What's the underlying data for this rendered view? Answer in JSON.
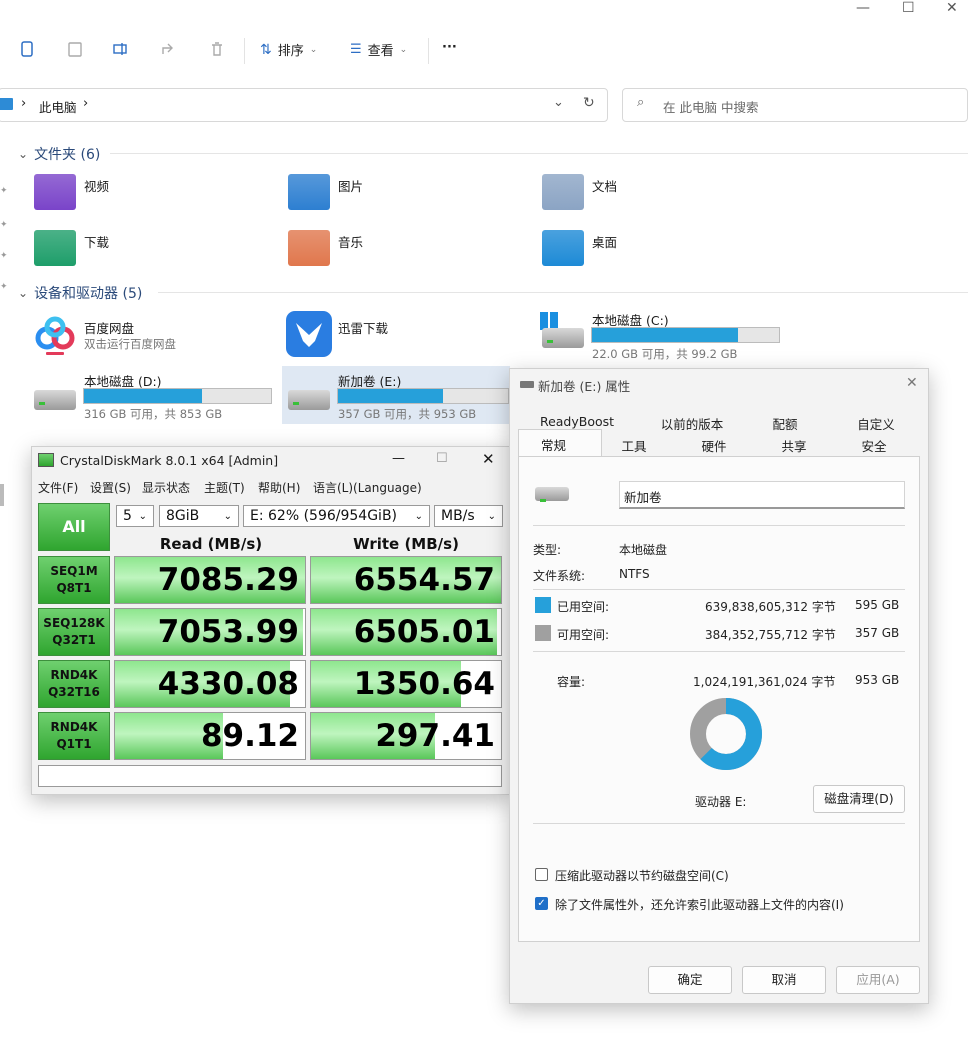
{
  "explorer": {
    "toolbar": {
      "sort_label": "排序",
      "view_label": "查看",
      "more_label": "···"
    },
    "address": {
      "root": "此电脑",
      "sep": "›"
    },
    "search": {
      "placeholder": "在 此电脑 中搜索"
    },
    "folders": {
      "header": "文件夹 (6)",
      "items": [
        {
          "name": "视频",
          "color": "#7a44c9"
        },
        {
          "name": "图片",
          "color": "#2d7fd1"
        },
        {
          "name": "文档",
          "color": "#8ba4c4"
        },
        {
          "name": "下载",
          "color": "#1e9e6a"
        },
        {
          "name": "音乐",
          "color": "#e0774d"
        },
        {
          "name": "桌面",
          "color": "#1d8ad6"
        }
      ]
    },
    "devices": {
      "header": "设备和驱动器 (5)",
      "items": [
        {
          "name": "百度网盘",
          "sub": "双击运行百度网盘"
        },
        {
          "name": "迅雷下载",
          "sub": ""
        },
        {
          "name": "本地磁盘 (C:)",
          "sub": "22.0 GB 可用，共 99.2 GB",
          "used_fraction": 0.78
        },
        {
          "name": "本地磁盘 (D:)",
          "sub": "316 GB 可用，共 853 GB",
          "used_fraction": 0.63
        },
        {
          "name": "新加卷 (E:)",
          "sub": "357 GB 可用，共 953 GB",
          "used_fraction": 0.62
        }
      ]
    }
  },
  "cdm": {
    "title": "CrystalDiskMark 8.0.1 x64 [Admin]",
    "menu": [
      "文件(F)",
      "设置(S)",
      "显示状态",
      "主题(T)",
      "帮助(H)",
      "语言(L)(Language)"
    ],
    "all_label": "All",
    "count": "5",
    "size": "8GiB",
    "drive": "E: 62% (596/954GiB)",
    "unit": "MB/s",
    "read_header": "Read (MB/s)",
    "write_header": "Write (MB/s)",
    "rows": [
      {
        "l1": "SEQ1M",
        "l2": "Q8T1",
        "read": "7085.29",
        "write": "6554.57",
        "read_fill": 1.0,
        "write_fill": 1.0
      },
      {
        "l1": "SEQ128K",
        "l2": "Q32T1",
        "read": "7053.99",
        "write": "6505.01",
        "read_fill": 0.99,
        "write_fill": 0.98
      },
      {
        "l1": "RND4K",
        "l2": "Q32T16",
        "read": "4330.08",
        "write": "1350.64",
        "read_fill": 0.92,
        "write_fill": 0.79
      },
      {
        "l1": "RND4K",
        "l2": "Q1T1",
        "read": "89.12",
        "write": "297.41",
        "read_fill": 0.57,
        "write_fill": 0.65
      }
    ]
  },
  "props": {
    "title": "新加卷 (E:) 属性",
    "tabs_top": [
      "ReadyBoost",
      "以前的版本",
      "配额",
      "自定义"
    ],
    "tabs_bottom": [
      "常规",
      "工具",
      "硬件",
      "共享",
      "安全"
    ],
    "volume_name": "新加卷",
    "type_label": "类型:",
    "type_value": "本地磁盘",
    "fs_label": "文件系统:",
    "fs_value": "NTFS",
    "used_label": "已用空间:",
    "used_bytes": "639,838,605,312 字节",
    "used_gb": "595 GB",
    "free_label": "可用空间:",
    "free_bytes": "384,352,755,712 字节",
    "free_gb": "357 GB",
    "cap_label": "容量:",
    "cap_bytes": "1,024,191,361,024 字节",
    "cap_gb": "953 GB",
    "used_fraction": 0.625,
    "drive_label": "驱动器 E:",
    "cleanup_label": "磁盘清理(D)",
    "compress_label": "压缩此驱动器以节约磁盘空间(C)",
    "index_label": "除了文件属性外，还允许索引此驱动器上文件的内容(I)",
    "ok_label": "确定",
    "cancel_label": "取消",
    "apply_label": "应用(A)",
    "used_color": "#26a0da",
    "free_color": "#a0a0a0"
  }
}
